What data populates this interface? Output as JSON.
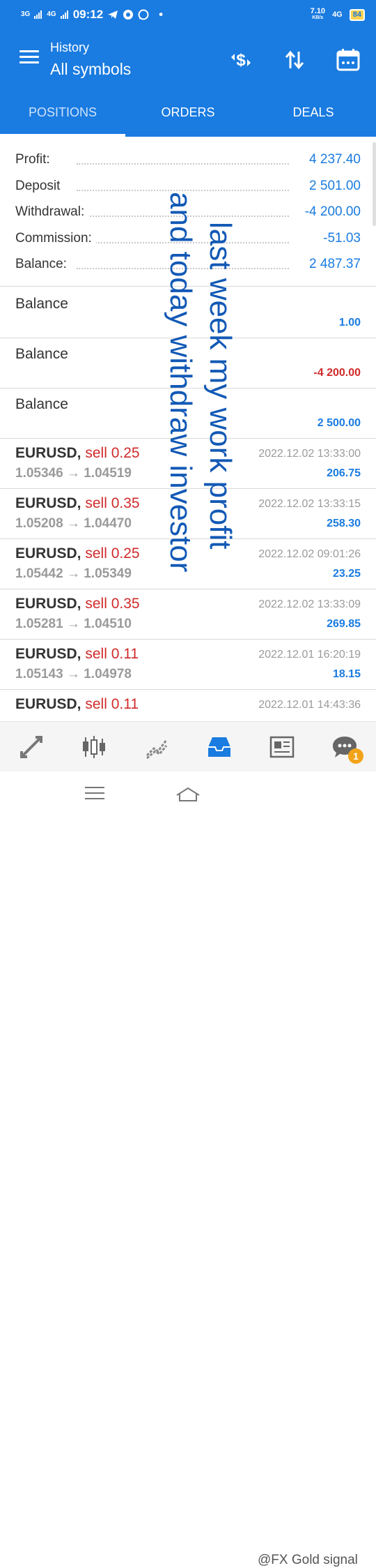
{
  "status": {
    "signal_labels": [
      "3G",
      "4G"
    ],
    "time": "09:12",
    "speed": "7.10",
    "speed_unit": "KB/s",
    "network": "4G",
    "battery": "84"
  },
  "header": {
    "subtitle": "History",
    "title": "All symbols",
    "icons": [
      "currency-exchange-icon",
      "sort-arrows-icon",
      "calendar-icon"
    ]
  },
  "tabs": [
    {
      "label": "POSITIONS",
      "active": true
    },
    {
      "label": "ORDERS",
      "active": false
    },
    {
      "label": "DEALS",
      "active": false
    }
  ],
  "summary": [
    {
      "label": "Profit:",
      "value": "4 237.40"
    },
    {
      "label": "Deposit",
      "value": "2 501.00"
    },
    {
      "label": "Withdrawal:",
      "value": "-4 200.00"
    },
    {
      "label": "Commission:",
      "value": "-51.03"
    },
    {
      "label": "Balance:",
      "value": "2 487.37"
    }
  ],
  "balances": [
    {
      "title": "Balance",
      "amount": "1.00",
      "color": "#1a7be0"
    },
    {
      "title": "Balance",
      "amount": "-4 200.00",
      "color": "#d02a2a"
    },
    {
      "title": "Balance",
      "amount": "2 500.00",
      "color": "#1a7be0"
    }
  ],
  "deals": [
    {
      "symbol": "EURUSD,",
      "side": "sell 0.25",
      "prices": "1.05346 → 1.04519",
      "time": "2022.12.02 13:33:00",
      "profit": "206.75"
    },
    {
      "symbol": "EURUSD,",
      "side": "sell 0.35",
      "prices": "1.05208 → 1.04470",
      "time": "2022.12.02 13:33:15",
      "profit": "258.30"
    },
    {
      "symbol": "EURUSD,",
      "side": "sell 0.25",
      "prices": "1.05442 → 1.05349",
      "time": "2022.12.02 09:01:26",
      "profit": "23.25"
    },
    {
      "symbol": "EURUSD,",
      "side": "sell 0.35",
      "prices": "1.05281 → 1.04510",
      "time": "2022.12.02 13:33:09",
      "profit": "269.85"
    },
    {
      "symbol": "EURUSD,",
      "side": "sell 0.11",
      "prices": "1.05143 → 1.04978",
      "time": "2022.12.01 16:20:19",
      "profit": "18.15"
    },
    {
      "symbol": "EURUSD,",
      "side": "sell 0.11",
      "prices": "",
      "time": "2022.12.01 14:43:36",
      "profit": ""
    }
  ],
  "overlay": {
    "line1": "last week my work profit",
    "line2": "and today withdraw investor"
  },
  "bottom_nav": {
    "items": [
      "quotes-icon",
      "chart-candles-icon",
      "trade-icon",
      "history-icon",
      "news-icon",
      "chat-icon"
    ],
    "active": "history-icon",
    "chat_badge": "1"
  },
  "watermark": "@FX Gold signal",
  "colors": {
    "primary": "#1a7be0",
    "negative": "#d02a2a",
    "muted": "#9a9a9a",
    "overlay": "#1259b5"
  }
}
